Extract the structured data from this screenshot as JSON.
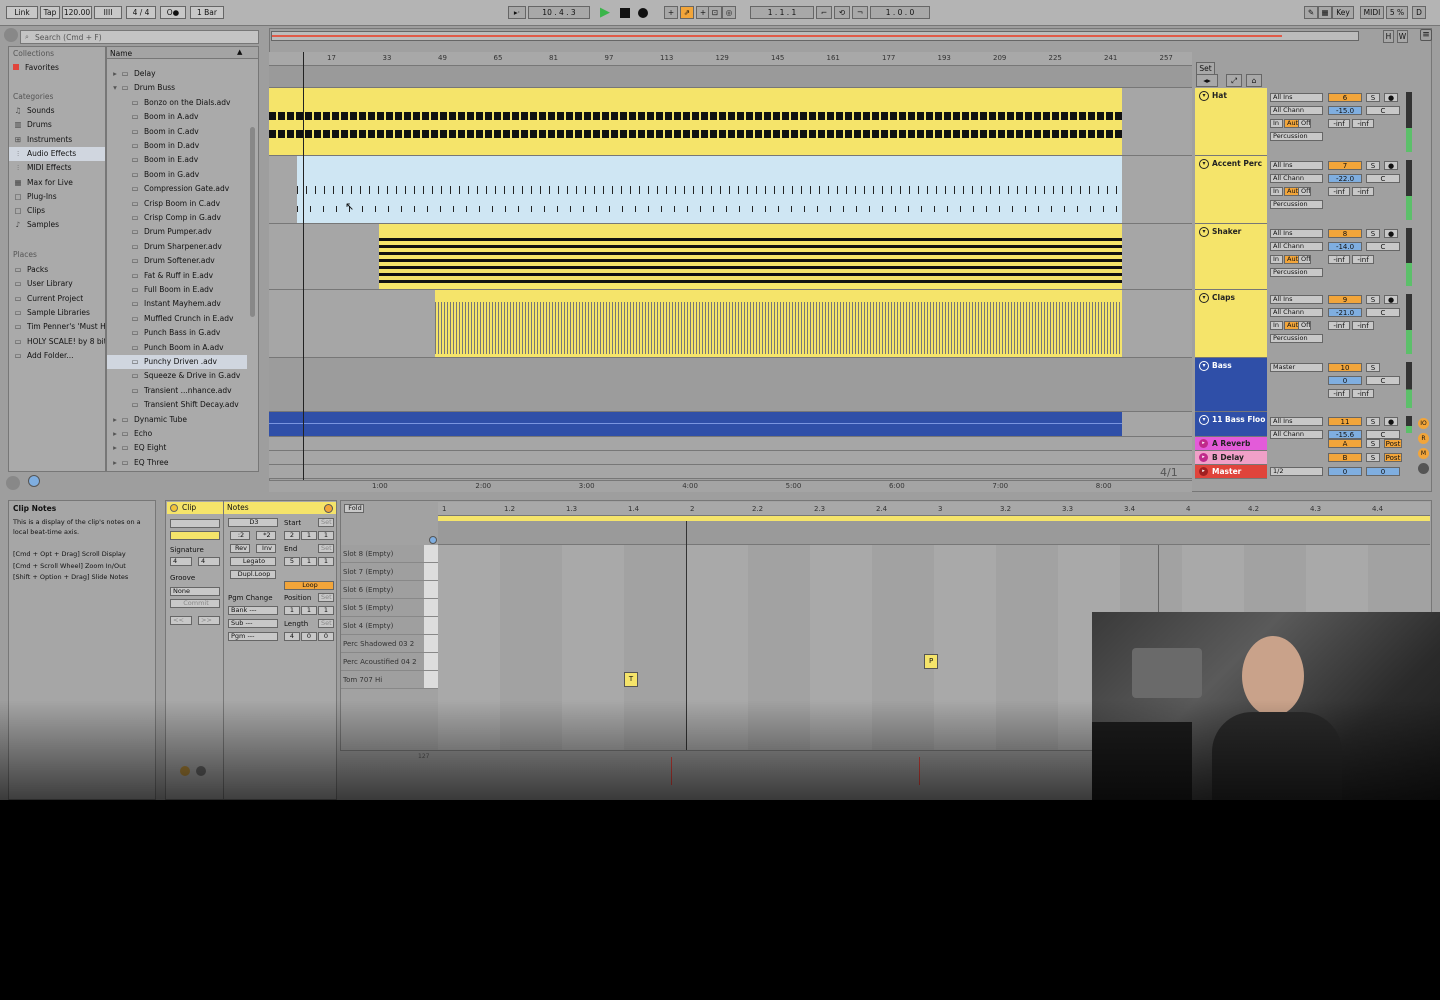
{
  "toolbar": {
    "link": "Link",
    "tap": "Tap",
    "tempo": "120.00",
    "signature": "4 / 4",
    "quantize": "1 Bar",
    "position": "10 .  4 .  3",
    "loop_start": "1 .  1 .  1",
    "loop_length": "1 .  0 .  0",
    "key": "Key",
    "midi": "MIDI",
    "cpu": "5 %",
    "d": "D"
  },
  "browser": {
    "search_placeholder": "Search (Cmd + F)",
    "collections_label": "Collections",
    "favorites": "Favorites",
    "categories_label": "Categories",
    "categories": [
      "Sounds",
      "Drums",
      "Instruments",
      "Audio Effects",
      "MIDI Effects",
      "Max for Live",
      "Plug-Ins",
      "Clips",
      "Samples"
    ],
    "selected_category": "Audio Effects",
    "places_label": "Places",
    "places": [
      "Packs",
      "User Library",
      "Current Project",
      "Sample Libraries",
      "Tim Penner's 'Must H",
      "HOLY SCALE! by 8 bit",
      "Add Folder..."
    ],
    "name_header": "Name",
    "items": [
      {
        "label": "Delay",
        "kind": "folder"
      },
      {
        "label": "Drum Buss",
        "kind": "folder-open"
      },
      {
        "label": "Bonzo on the Dials.adv",
        "kind": "file"
      },
      {
        "label": "Boom in A.adv",
        "kind": "file"
      },
      {
        "label": "Boom in C.adv",
        "kind": "file"
      },
      {
        "label": "Boom in D.adv",
        "kind": "file"
      },
      {
        "label": "Boom in E.adv",
        "kind": "file"
      },
      {
        "label": "Boom in G.adv",
        "kind": "file"
      },
      {
        "label": "Compression Gate.adv",
        "kind": "file"
      },
      {
        "label": "Crisp Boom in C.adv",
        "kind": "file"
      },
      {
        "label": "Crisp Comp in G.adv",
        "kind": "file"
      },
      {
        "label": "Drum Pumper.adv",
        "kind": "file"
      },
      {
        "label": "Drum Sharpener.adv",
        "kind": "file"
      },
      {
        "label": "Drum Softener.adv",
        "kind": "file"
      },
      {
        "label": "Fat & Ruff in E.adv",
        "kind": "file"
      },
      {
        "label": "Full Boom in E.adv",
        "kind": "file"
      },
      {
        "label": "Instant Mayhem.adv",
        "kind": "file"
      },
      {
        "label": "Muffled Crunch in E.adv",
        "kind": "file"
      },
      {
        "label": "Punch Bass in G.adv",
        "kind": "file"
      },
      {
        "label": "Punch Boom in A.adv",
        "kind": "file"
      },
      {
        "label": "Punchy Driven .adv",
        "kind": "file-selected"
      },
      {
        "label": "Squeeze & Drive in G.adv",
        "kind": "file"
      },
      {
        "label": "Transient ...nhance.adv",
        "kind": "file"
      },
      {
        "label": "Transient Shift Decay.adv",
        "kind": "file"
      },
      {
        "label": "Dynamic Tube",
        "kind": "folder"
      },
      {
        "label": "Echo",
        "kind": "folder"
      },
      {
        "label": "EQ Eight",
        "kind": "folder"
      },
      {
        "label": "EQ Three",
        "kind": "folder"
      }
    ]
  },
  "arrangement": {
    "bar_ticks": [
      "17",
      "33",
      "49",
      "65",
      "81",
      "97",
      "113",
      "129",
      "145",
      "161",
      "177",
      "193",
      "209",
      "225",
      "241",
      "257"
    ],
    "time_ticks": [
      "1:00",
      "2:00",
      "3:00",
      "4:00",
      "5:00",
      "6:00",
      "7:00",
      "8:00"
    ],
    "set_label": "Set",
    "time_sig": "4/1",
    "tracks": [
      {
        "name": "Hat",
        "input": "All Ins",
        "channel": "All Chann",
        "monitor": [
          "In",
          "Auto",
          "Off"
        ],
        "output": "Percussion",
        "number": "6",
        "volume": "-15.0",
        "pan": "C",
        "sends": [
          "-inf",
          "-inf"
        ]
      },
      {
        "name": "Accent Perc",
        "input": "All Ins",
        "channel": "All Chann",
        "monitor": [
          "In",
          "Auto",
          "Off"
        ],
        "output": "Percussion",
        "number": "7",
        "volume": "-22.0",
        "pan": "C",
        "sends": [
          "-inf",
          "-inf"
        ]
      },
      {
        "name": "Shaker",
        "input": "All Ins",
        "channel": "All Chann",
        "monitor": [
          "In",
          "Auto",
          "Off"
        ],
        "output": "Percussion",
        "number": "8",
        "volume": "-14.0",
        "pan": "C",
        "sends": [
          "-inf",
          "-inf"
        ]
      },
      {
        "name": "Claps",
        "input": "All Ins",
        "channel": "All Chann",
        "monitor": [
          "In",
          "Auto",
          "Off"
        ],
        "output": "Percussion",
        "number": "9",
        "volume": "-21.0",
        "pan": "C",
        "sends": [
          "-inf",
          "-inf"
        ]
      },
      {
        "name": "Bass",
        "output": "Master",
        "number": "10",
        "volume": "0",
        "pan": "C",
        "sends": [
          "-inf",
          "-inf"
        ]
      },
      {
        "name": "11 Bass Floo",
        "input": "All Ins",
        "channel": "All Chann",
        "number": "11",
        "volume": "-15.6",
        "pan": "C"
      }
    ],
    "returns": [
      {
        "name": "A Reverb",
        "letter": "A",
        "post": "Post"
      },
      {
        "name": "B Delay",
        "letter": "B",
        "post": "Post"
      }
    ],
    "master": {
      "name": "Master",
      "cue": "1/2",
      "volume": "0",
      "pan": "0"
    },
    "s_label": "S"
  },
  "clip_notes": {
    "title": "Clip Notes",
    "body": "This is a display of the clip's notes on a local beat-time axis.",
    "hints": [
      "[Cmd + Opt + Drag] Scroll Display",
      "[Cmd + Scroll Wheel] Zoom In/Out",
      "[Shift + Option + Drag] Slide Notes"
    ]
  },
  "clip_panel": {
    "clip_label": "Clip",
    "notes_label": "Notes",
    "signature_label": "Signature",
    "sig_num": "4",
    "sig_den": "4",
    "groove_label": "Groove",
    "groove_value": "None",
    "commit": "Commit",
    "note_name": "D3",
    "half": ":2",
    "double": "*2",
    "rev": "Rev",
    "inv": "Inv",
    "legato": "Legato",
    "dupl": "Dupl.Loop",
    "pgm_change": "Pgm Change",
    "bank": "Bank ---",
    "sub": "Sub ---",
    "pgm": "Pgm ---",
    "start_label": "Start",
    "end_label": "End",
    "set": "Set",
    "loop": "Loop",
    "position_label": "Position",
    "length_label": "Length",
    "start": [
      "2",
      "1",
      "1"
    ],
    "end": [
      "5",
      "1",
      "1"
    ],
    "position": [
      "1",
      "1",
      "1"
    ],
    "length": [
      "4",
      "0",
      "0"
    ]
  },
  "midi_editor": {
    "fold": "Fold",
    "ruler": [
      "1",
      "1.2",
      "1.3",
      "1.4",
      "2",
      "2.2",
      "2.3",
      "2.4",
      "3",
      "3.2",
      "3.3",
      "3.4",
      "4",
      "4.2",
      "4.3",
      "4.4"
    ],
    "lanes": [
      "Slot 8 (Empty)",
      "Slot 7 (Empty)",
      "Slot 6 (Empty)",
      "Slot 5 (Empty)",
      "Slot 4 (Empty)",
      "Perc Shadowed 03 2",
      "Perc Acoustified 04 2",
      "Tom 707 Hi"
    ],
    "notes": [
      {
        "label": "T",
        "lane": "Tom 707 Hi",
        "beat": 1.75
      },
      {
        "label": "P",
        "lane": "Perc Acoustified 04 2",
        "beat": 2.96
      }
    ],
    "velocity_max": "127"
  }
}
